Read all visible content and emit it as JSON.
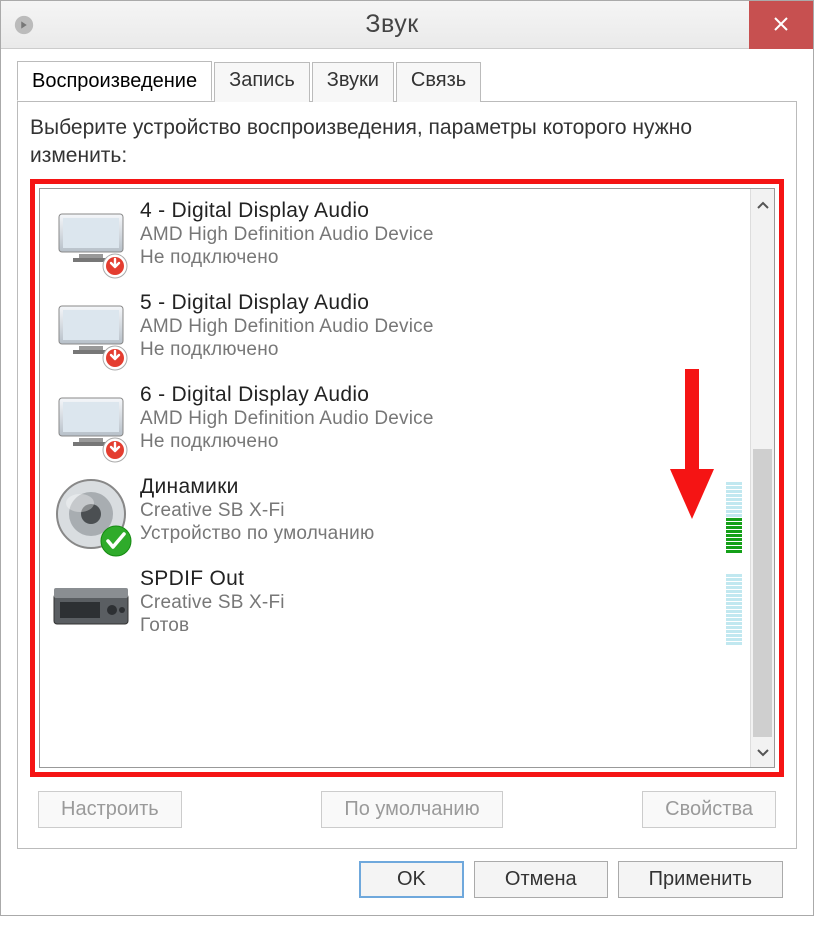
{
  "window": {
    "title": "Звук"
  },
  "tabs": [
    {
      "label": "Воспроизведение",
      "active": true
    },
    {
      "label": "Запись"
    },
    {
      "label": "Звуки"
    },
    {
      "label": "Связь"
    }
  ],
  "instruction": "Выберите устройство воспроизведения, параметры которого нужно изменить:",
  "devices": [
    {
      "name": "4 - Digital Display Audio",
      "driver": "AMD High Definition Audio Device",
      "status": "Не подключено",
      "icon": "monitor",
      "badge": "down"
    },
    {
      "name": "5 - Digital Display Audio",
      "driver": "AMD High Definition Audio Device",
      "status": "Не подключено",
      "icon": "monitor",
      "badge": "down"
    },
    {
      "name": "6 - Digital Display Audio",
      "driver": "AMD High Definition Audio Device",
      "status": "Не подключено",
      "icon": "monitor",
      "badge": "down"
    },
    {
      "name": "Динамики",
      "driver": "Creative SB X-Fi",
      "status": "Устройство по умолчанию",
      "icon": "speaker",
      "badge": "check",
      "level_active": 9,
      "level_total": 18
    },
    {
      "name": "SPDIF Out",
      "driver": "Creative SB X-Fi",
      "status": "Готов",
      "icon": "spdif",
      "badge": "none",
      "level_active": 0,
      "level_total": 18
    }
  ],
  "actions": {
    "configure": "Настроить",
    "default": "По умолчанию",
    "properties": "Свойства"
  },
  "footer": {
    "ok": "OK",
    "cancel": "Отмена",
    "apply": "Применить"
  }
}
